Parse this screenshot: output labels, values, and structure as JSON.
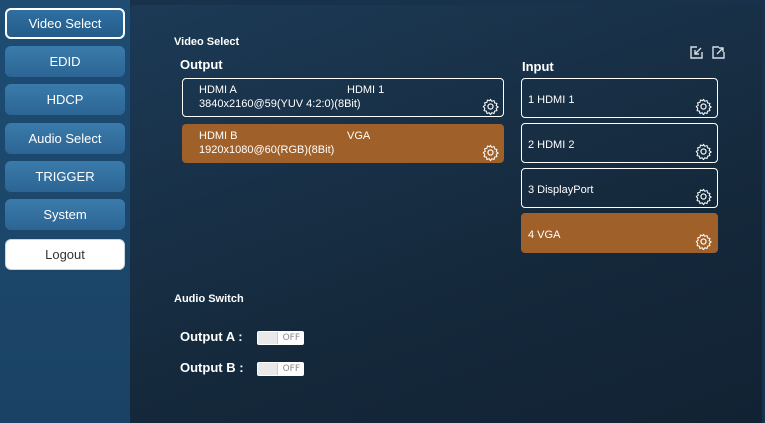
{
  "nav": {
    "items": [
      "Video Select",
      "EDID",
      "HDCP",
      "Audio Select",
      "TRIGGER",
      "System"
    ],
    "logout": "Logout"
  },
  "video_select": {
    "title": "Video Select",
    "output_title": "Output",
    "input_title": "Input",
    "outputs": [
      {
        "name": "HDMI A",
        "source": "HDMI 1",
        "resolution": "3840x2160@59(YUV 4:2:0)(8Bit)"
      },
      {
        "name": "HDMI B",
        "source": "VGA",
        "resolution": "1920x1080@60(RGB)(8Bit)"
      }
    ],
    "inputs": [
      "1  HDMI 1",
      "2  HDMI 2",
      "3  DisplayPort",
      "4  VGA"
    ]
  },
  "audio_switch": {
    "title": "Audio Switch",
    "rows": [
      {
        "label": "Output A :",
        "state": "OFF"
      },
      {
        "label": "Output B :",
        "state": "OFF"
      }
    ]
  },
  "colors": {
    "sidebar": "#1e4c73",
    "selected": "#a0602a",
    "background": "#15293c"
  }
}
